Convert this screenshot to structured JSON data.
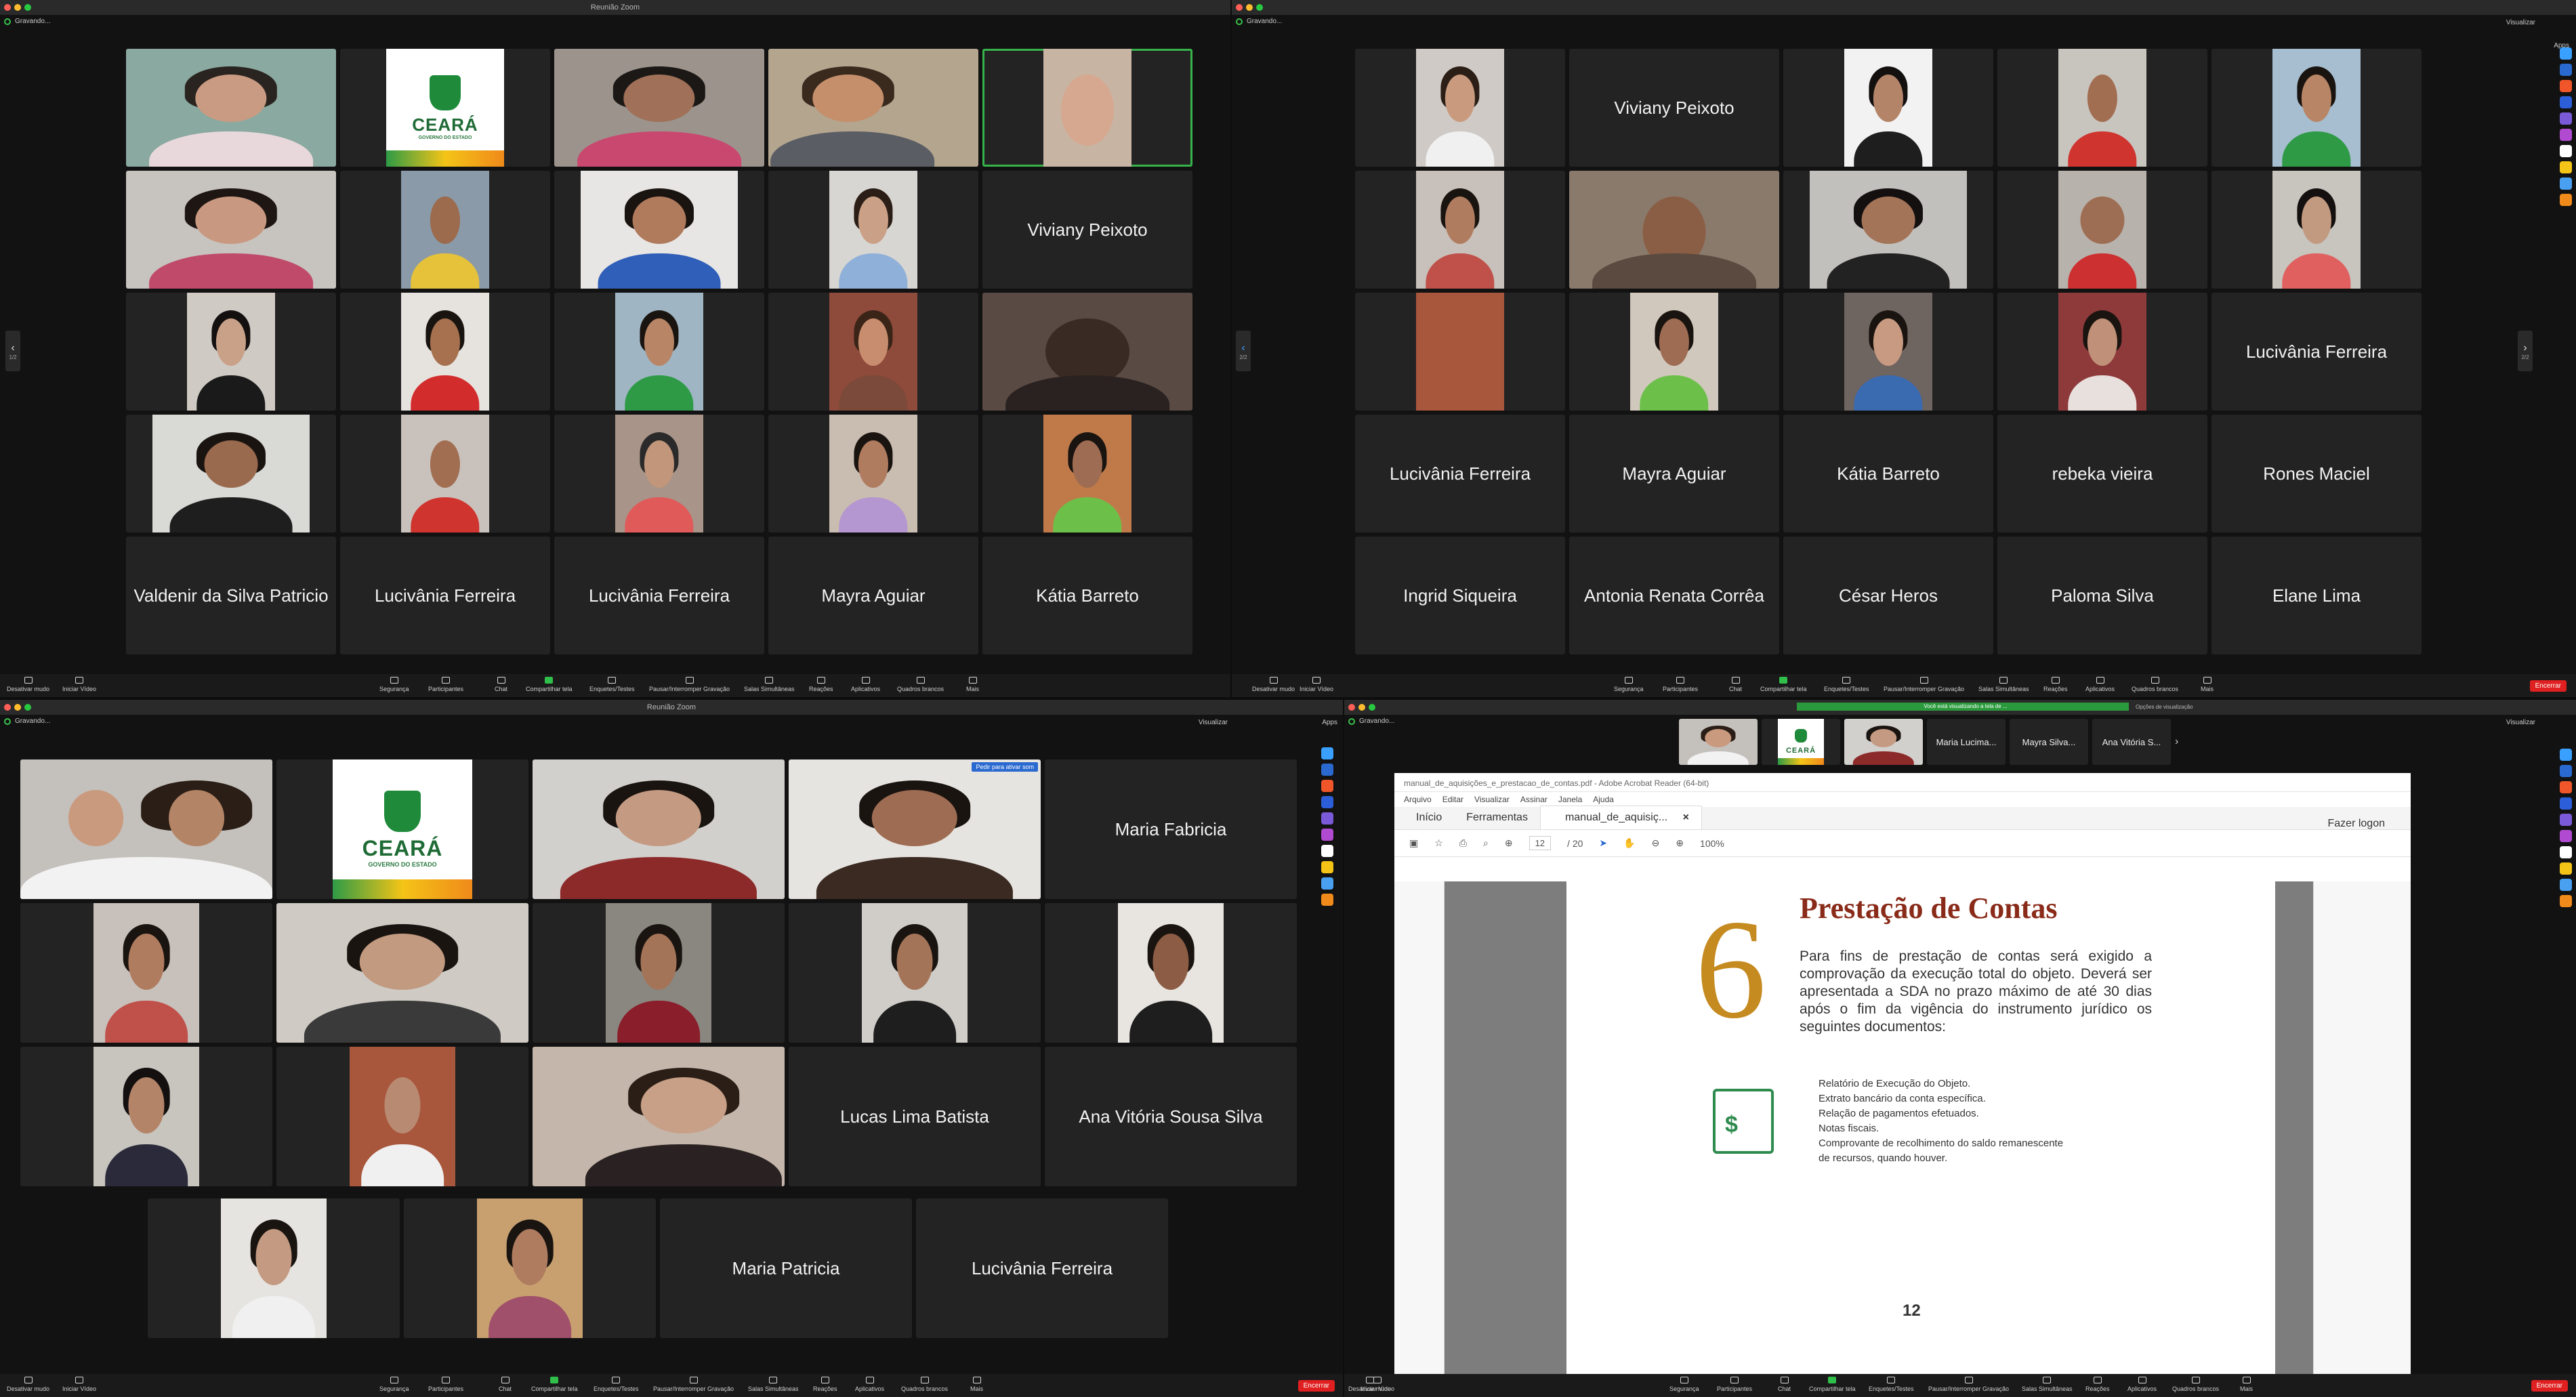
{
  "window_title": "Reunião Zoom",
  "recording_label": "Gravando...",
  "view_label": "Visualizar",
  "apps_label": "Apps",
  "toolbar": {
    "mute": "Desativar mudo",
    "video": "Iniciar Vídeo",
    "security": "Segurança",
    "participants": "Participantes",
    "chat": "Chat",
    "share": "Compartilhar tela",
    "polls": "Enquetes/Testes",
    "record": "Pausar/Interromper Gravação",
    "rooms": "Salas Simultâneas",
    "reactions": "Reações",
    "apps": "Aplicativos",
    "whiteboard": "Quadros brancos",
    "more": "Mais",
    "end": "Encerrar"
  },
  "pager": {
    "q1": "1/2",
    "q2_left": "2/2",
    "q2_right": "2/2"
  },
  "q1_names": [
    "Viviany Peixoto",
    "Valdenir da Silva Patricio",
    "Lucivânia Ferreira",
    "Lucivânia Ferreira",
    "Mayra Aguiar",
    "Kátia Barreto"
  ],
  "q2_names": [
    "Viviany Peixoto",
    "Lucivânia Ferreira",
    "Lucivânia Ferreira",
    "Mayra Aguiar",
    "Kátia Barreto",
    "rebeka vieira",
    "Rones Maciel",
    "Ingrid Siqueira",
    "Antonia Renata Corrêa",
    "César Heros",
    "Paloma Silva",
    "Elane Lima"
  ],
  "q3_names": [
    "Maria Fabricia",
    "Lucas Lima Batista",
    "Ana Vitória Sousa Silva",
    "Maria Patricia",
    "Lucivânia Ferreira"
  ],
  "q3_badge": "Pedir para ativar som",
  "logo": {
    "title": "CEARÁ",
    "subtitle": "GOVERNO DO ESTADO"
  },
  "q4": {
    "share_banner": "Você está visualizando a tela de ...",
    "view_options": "Opções de visualização",
    "strip_names": [
      "Maria Lucima...",
      "Mayra Silva...",
      "Ana Vitória S..."
    ],
    "acrobat": {
      "title": "manual_de_aquisições_e_prestacao_de_contas.pdf - Adobe Acrobat Reader (64-bit)",
      "menu": [
        "Arquivo",
        "Editar",
        "Visualizar",
        "Assinar",
        "Janela",
        "Ajuda"
      ],
      "tab_home": "Início",
      "tab_tools": "Ferramentas",
      "tab_doc": "manual_de_aquisiç...",
      "logon": "Fazer logon",
      "page_current": "12",
      "page_total": "/ 20",
      "zoom": "100%",
      "chapter_number": "6",
      "chapter_title": "Prestação de Contas",
      "paragraph": "Para fins de prestação de contas será exigido a comprovação da execução total do objeto. Deverá ser apresentada a SDA no prazo máximo de até 30 dias após o fim da vigência do instrumento jurídico os seguintes documentos:",
      "items": [
        "Relatório de Execução do Objeto.",
        "Extrato bancário da conta específica.",
        "Relação de pagamentos efetuados.",
        "Notas fiscais.",
        "Comprovante de recolhimento do saldo remanescente",
        "de recursos, quando houver."
      ],
      "page_number": "12"
    }
  },
  "colors": {
    "end": "#e02020",
    "active_speaker": "#36b34a",
    "title_red": "#8a2b1a",
    "accent_gold": "#c58a20"
  }
}
